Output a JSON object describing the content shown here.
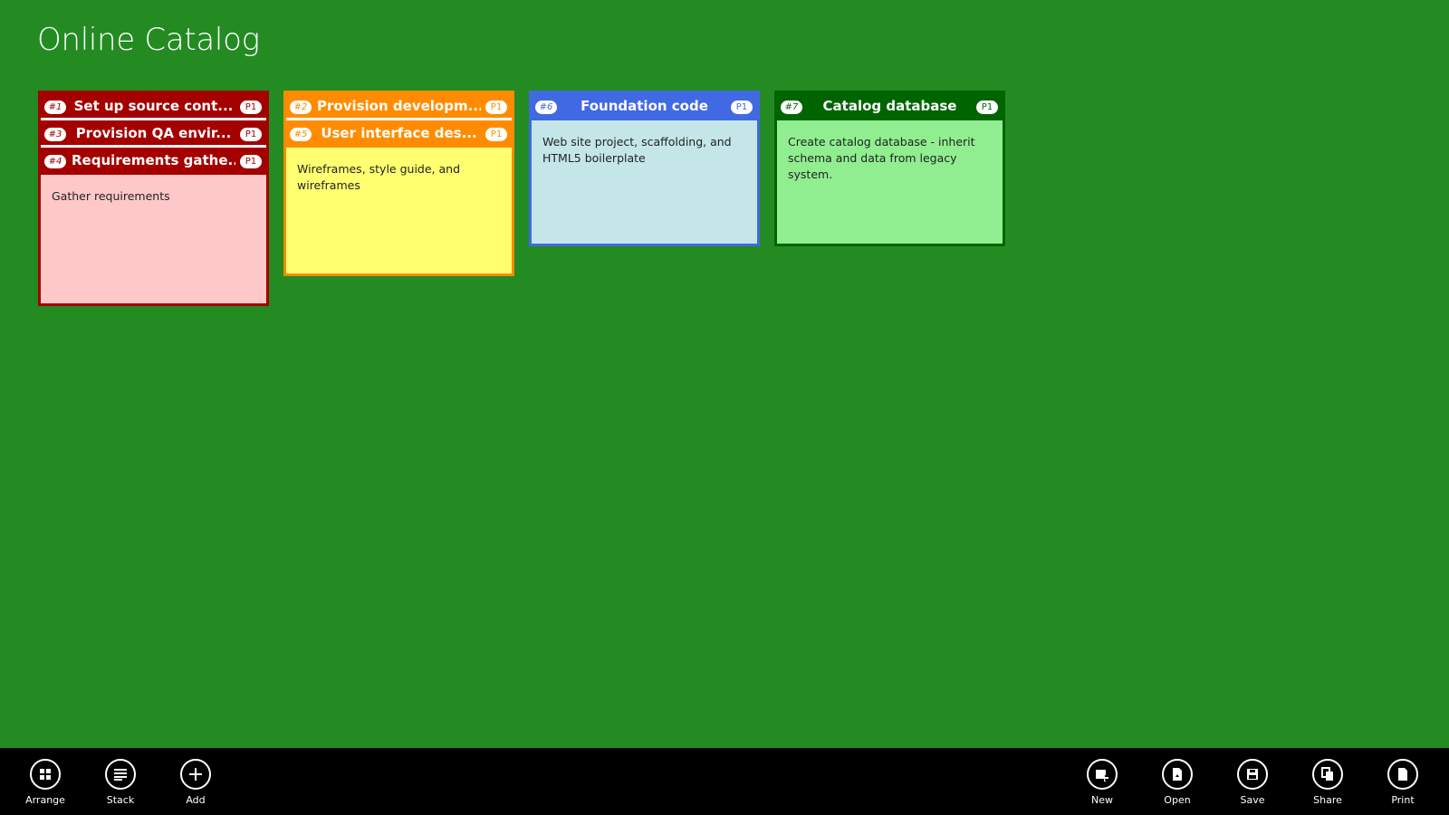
{
  "page": {
    "title": "Online Catalog"
  },
  "colors": {
    "background": "#238b22",
    "red_head": "#a40000",
    "red_body": "#ffc8c8",
    "orange_head": "#ff8c00",
    "yellow_body": "#ffff70",
    "blue_head": "#4169e1",
    "blue_body": "#c4e6e8",
    "green_head": "#006400",
    "green_body": "#91ee90"
  },
  "stacks": [
    {
      "cards": [
        {
          "number": "#1",
          "title": "Set up source cont...",
          "priority": "P1"
        },
        {
          "number": "#3",
          "title": "Provision QA envir...",
          "priority": "P1"
        },
        {
          "number": "#4",
          "title": "Requirements gathe...",
          "priority": "P1"
        }
      ],
      "body": "Gather requirements"
    },
    {
      "cards": [
        {
          "number": "#2",
          "title": "Provision developm...",
          "priority": "P1"
        },
        {
          "number": "#5",
          "title": "User interface des...",
          "priority": "P1"
        }
      ],
      "body": "Wireframes, style guide, and wireframes"
    },
    {
      "cards": [
        {
          "number": "#6",
          "title": "Foundation code",
          "priority": "P1"
        }
      ],
      "body": "Web site project, scaffolding, and HTML5 boilerplate"
    },
    {
      "cards": [
        {
          "number": "#7",
          "title": "Catalog database",
          "priority": "P1"
        }
      ],
      "body": "Create catalog database - inherit schema and data from legacy system."
    }
  ],
  "appbar": {
    "left": [
      {
        "label": "Arrange",
        "icon": "arrange-icon"
      },
      {
        "label": "Stack",
        "icon": "stack-icon"
      },
      {
        "label": "Add",
        "icon": "add-icon"
      }
    ],
    "right": [
      {
        "label": "New",
        "icon": "new-icon"
      },
      {
        "label": "Open",
        "icon": "open-icon"
      },
      {
        "label": "Save",
        "icon": "save-icon"
      },
      {
        "label": "Share",
        "icon": "share-icon"
      },
      {
        "label": "Print",
        "icon": "print-icon"
      }
    ]
  }
}
